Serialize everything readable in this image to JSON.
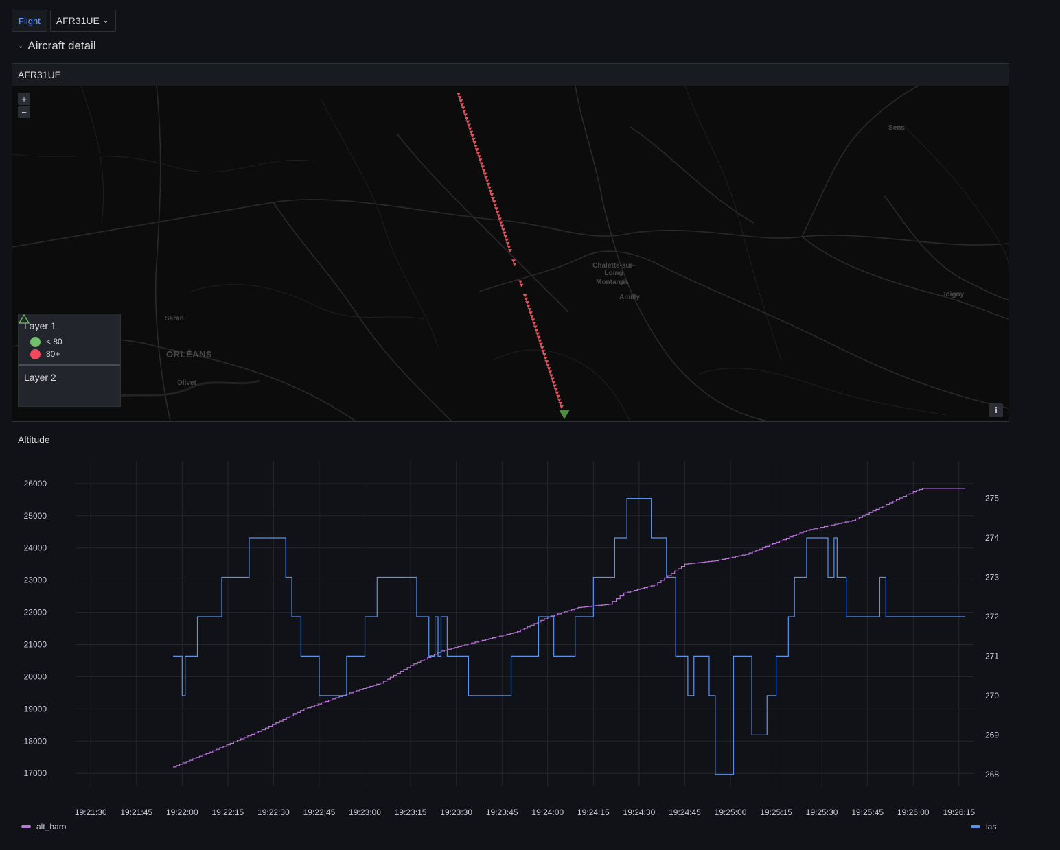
{
  "variables": {
    "flight_label": "Flight",
    "flight_value": "AFR31UE"
  },
  "row": {
    "title": "Aircraft detail"
  },
  "map_panel": {
    "title": "AFR31UE",
    "zoom_in": "+",
    "zoom_out": "−",
    "info": "i",
    "places": [
      "Sens",
      "Chalette-sur-Loing",
      "Montargis",
      "Amilly",
      "Joigny",
      "Saran",
      "ORLÉANS",
      "Olivet"
    ],
    "legend": {
      "layer1_title": "Layer 1",
      "layer1_items": [
        {
          "label": "< 80",
          "color": "#73bf69"
        },
        {
          "label": "80+",
          "color": "#f2495c"
        }
      ],
      "layer2_title": "Layer 2",
      "layer2_icon": "triangle-icon"
    },
    "colors": {
      "track": "#e0525c",
      "marker": "#4f8a3e"
    }
  },
  "altitude_panel": {
    "title": "Altitude",
    "legend_left": "alt_baro",
    "legend_right": "ias",
    "colors": {
      "alt_baro": "#b877d9",
      "ias": "#5794f2"
    }
  },
  "chart_data": {
    "type": "line",
    "title": "Altitude",
    "x_ticks": [
      "19:21:30",
      "19:21:45",
      "19:22:00",
      "19:22:15",
      "19:22:30",
      "19:22:45",
      "19:23:00",
      "19:23:15",
      "19:23:30",
      "19:23:45",
      "19:24:00",
      "19:24:15",
      "19:24:30",
      "19:24:45",
      "19:25:00",
      "19:25:15",
      "19:25:30",
      "19:25:45",
      "19:26:00",
      "19:26:15"
    ],
    "y_left_ticks": [
      17000,
      18000,
      19000,
      20000,
      21000,
      22000,
      23000,
      24000,
      25000,
      26000
    ],
    "y_left_range": [
      16600,
      26700
    ],
    "y_right_ticks": [
      268,
      269,
      270,
      271,
      272,
      273,
      274,
      275
    ],
    "y_right_range": [
      267.7,
      275.95
    ],
    "x_range": [
      "19:21:25",
      "19:26:20"
    ],
    "grid": true,
    "legend_placement": "bottom",
    "series": [
      {
        "name": "alt_baro",
        "axis": "left",
        "color": "#b877d9",
        "points": [
          [
            "19:21:57",
            17200
          ],
          [
            "19:22:10",
            17700
          ],
          [
            "19:22:25",
            18300
          ],
          [
            "19:22:40",
            19000
          ],
          [
            "19:22:55",
            19500
          ],
          [
            "19:23:05",
            19800
          ],
          [
            "19:23:15",
            20350
          ],
          [
            "19:23:25",
            20800
          ],
          [
            "19:23:35",
            21050
          ],
          [
            "19:23:50",
            21400
          ],
          [
            "19:24:00",
            21850
          ],
          [
            "19:24:10",
            22150
          ],
          [
            "19:24:20",
            22250
          ],
          [
            "19:24:25",
            22600
          ],
          [
            "19:24:35",
            22850
          ],
          [
            "19:24:45",
            23500
          ],
          [
            "19:24:55",
            23600
          ],
          [
            "19:25:05",
            23800
          ],
          [
            "19:25:25",
            24550
          ],
          [
            "19:25:40",
            24850
          ],
          [
            "19:26:00",
            25750
          ],
          [
            "19:26:03",
            25850
          ],
          [
            "19:26:17",
            25850
          ]
        ]
      },
      {
        "name": "ias",
        "axis": "right",
        "color": "#5794f2",
        "step": true,
        "points": [
          [
            "19:21:57",
            271
          ],
          [
            "19:22:00",
            270
          ],
          [
            "19:22:01",
            271
          ],
          [
            "19:22:05",
            272
          ],
          [
            "19:22:13",
            273
          ],
          [
            "19:22:22",
            274
          ],
          [
            "19:22:34",
            273
          ],
          [
            "19:22:36",
            272
          ],
          [
            "19:22:39",
            271
          ],
          [
            "19:22:45",
            270
          ],
          [
            "19:22:54",
            271
          ],
          [
            "19:23:00",
            272
          ],
          [
            "19:23:04",
            273
          ],
          [
            "19:23:17",
            272
          ],
          [
            "19:23:21",
            271
          ],
          [
            "19:23:23",
            272
          ],
          [
            "19:23:24",
            271
          ],
          [
            "19:23:25",
            272
          ],
          [
            "19:23:27",
            271
          ],
          [
            "19:23:34",
            270
          ],
          [
            "19:23:48",
            271
          ],
          [
            "19:23:57",
            272
          ],
          [
            "19:24:02",
            271
          ],
          [
            "19:24:09",
            272
          ],
          [
            "19:24:15",
            273
          ],
          [
            "19:24:22",
            274
          ],
          [
            "19:24:26",
            275
          ],
          [
            "19:24:34",
            274
          ],
          [
            "19:24:39",
            273
          ],
          [
            "19:24:42",
            271
          ],
          [
            "19:24:46",
            270
          ],
          [
            "19:24:48",
            271
          ],
          [
            "19:24:53",
            270
          ],
          [
            "19:24:55",
            268
          ],
          [
            "19:25:01",
            271
          ],
          [
            "19:25:07",
            269
          ],
          [
            "19:25:12",
            270
          ],
          [
            "19:25:15",
            271
          ],
          [
            "19:25:19",
            272
          ],
          [
            "19:25:21",
            273
          ],
          [
            "19:25:25",
            274
          ],
          [
            "19:25:32",
            273
          ],
          [
            "19:25:34",
            274
          ],
          [
            "19:25:35",
            273
          ],
          [
            "19:25:38",
            272
          ],
          [
            "19:25:49",
            273
          ],
          [
            "19:25:51",
            272
          ],
          [
            "19:26:17",
            272
          ]
        ]
      }
    ]
  }
}
